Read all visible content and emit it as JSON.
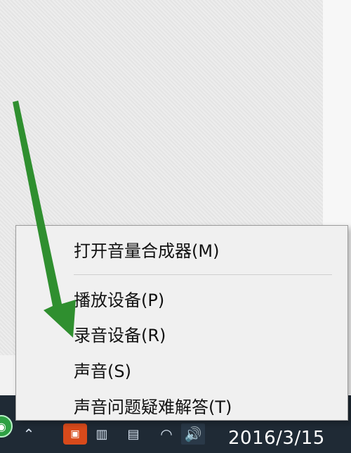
{
  "menu": {
    "items": [
      {
        "label": "打开音量合成器(M)"
      },
      {
        "label": "播放设备(P)"
      },
      {
        "label": "录音设备(R)"
      },
      {
        "label": "声音(S)"
      },
      {
        "label": "声音问题疑难解答(T)"
      }
    ]
  },
  "taskbar": {
    "clock_date": "2016/3/15"
  },
  "icons": {
    "start": "start-icon",
    "chevron": "chevron-up-icon",
    "app1": "app-icon",
    "app2": "app-icon",
    "app3": "app-icon",
    "network": "wifi-icon",
    "speaker": "speaker-icon"
  },
  "colors": {
    "arrow": "#2f8f2f",
    "taskbar": "#1f2a35",
    "menu_background": "#f0f0f0"
  }
}
